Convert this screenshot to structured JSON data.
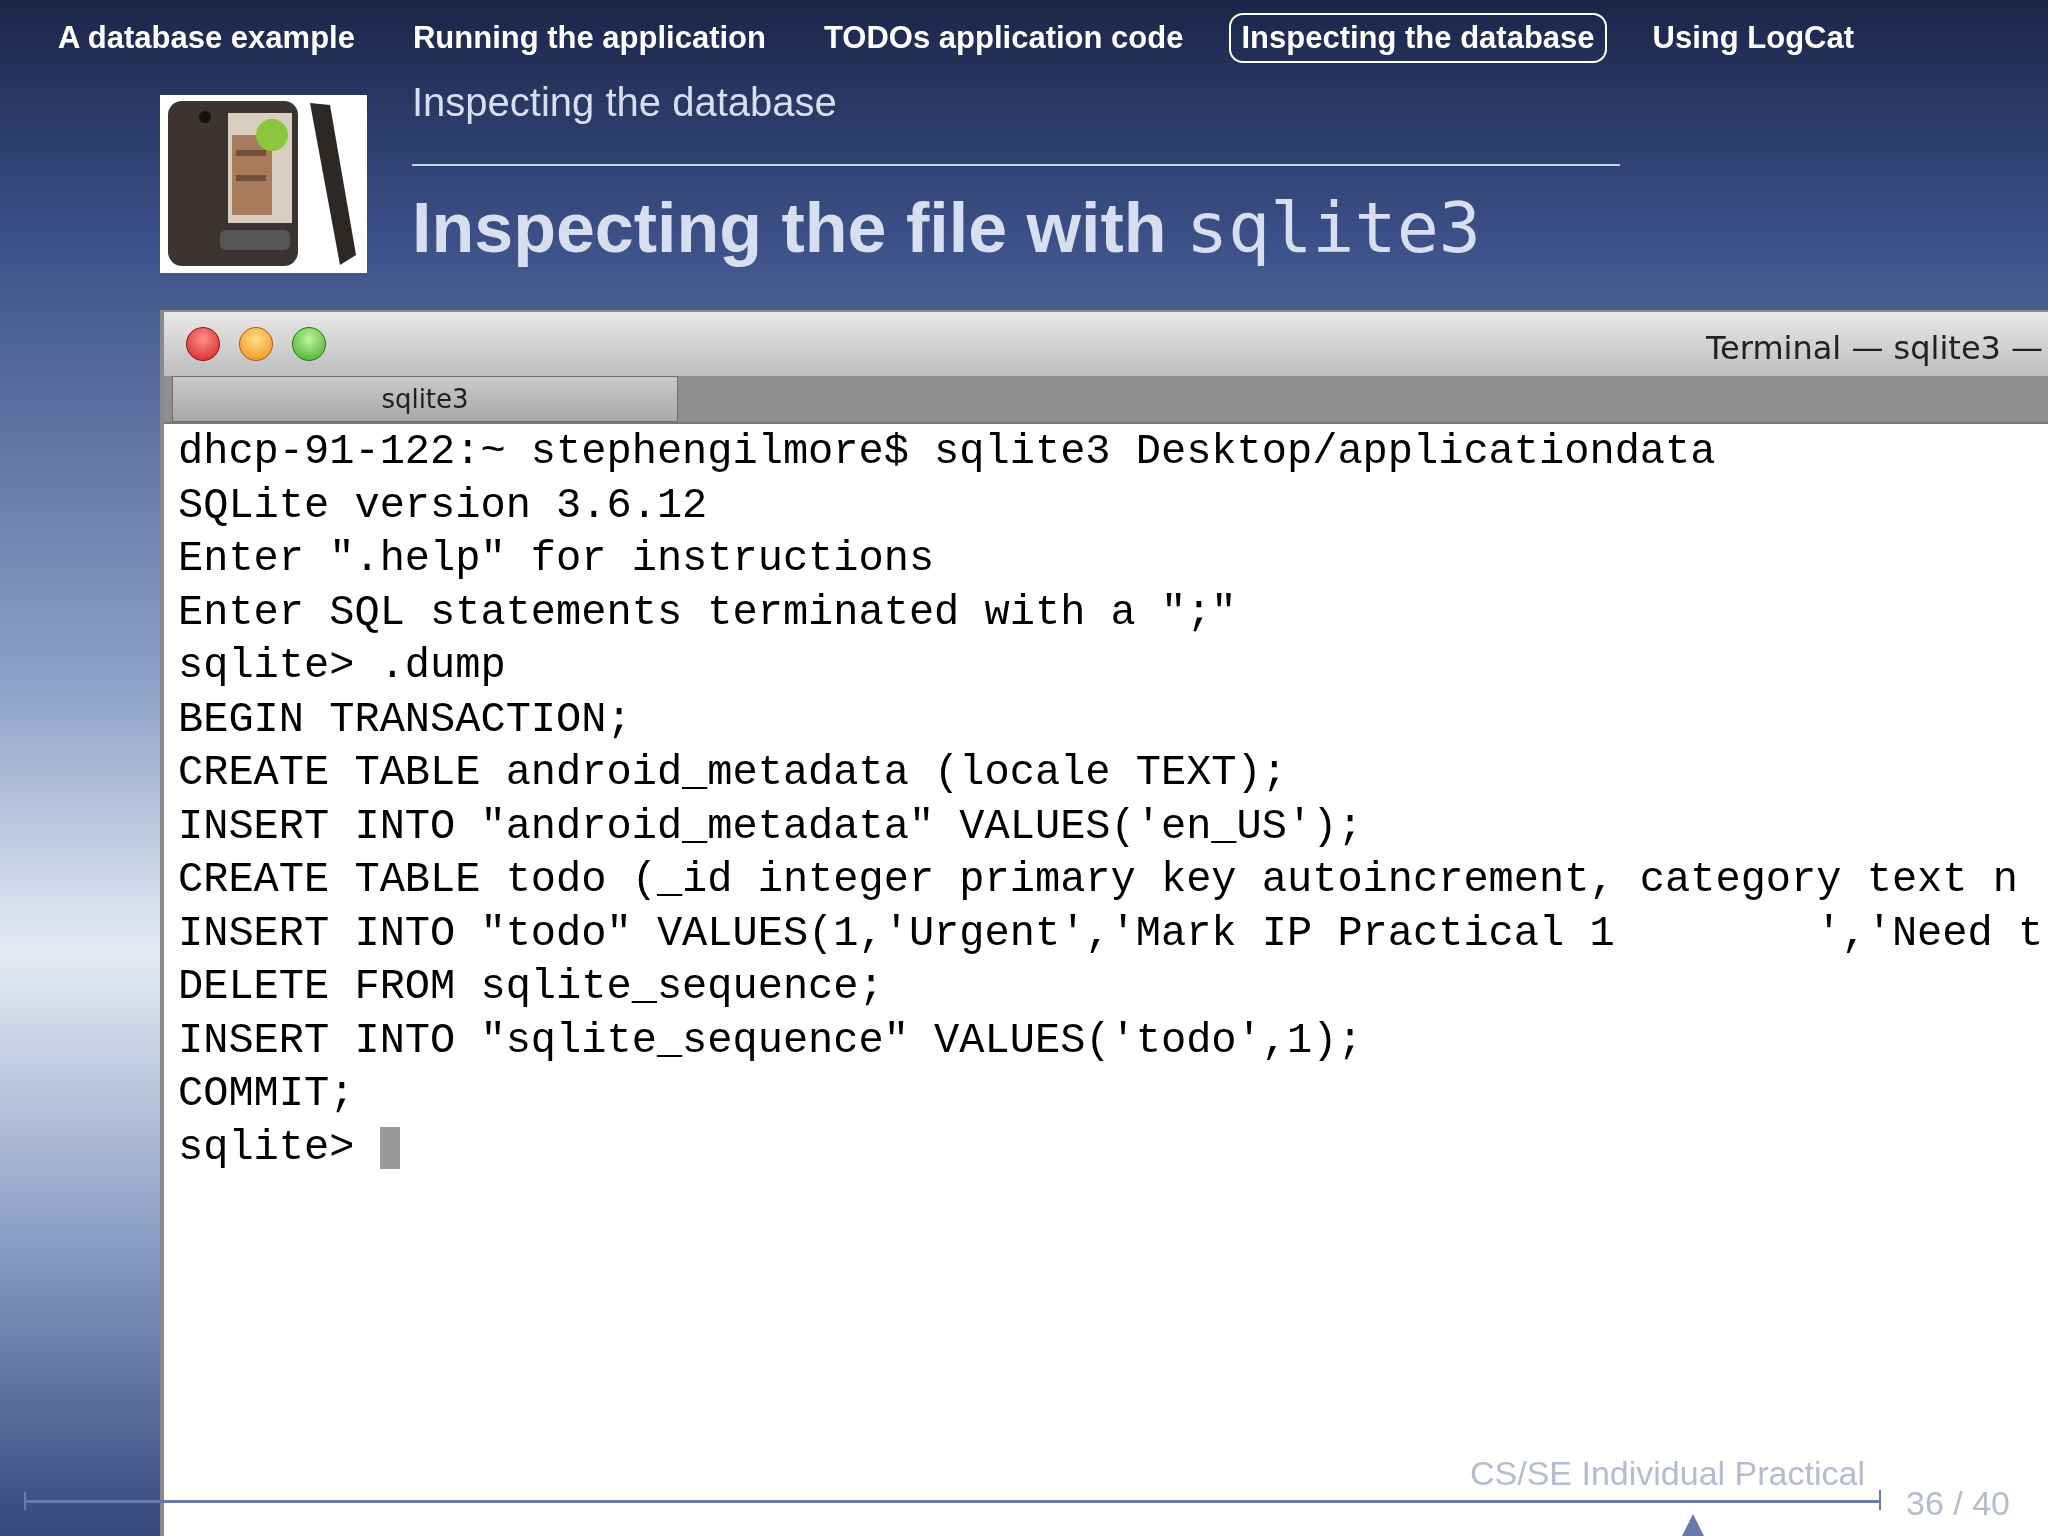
{
  "nav": [
    {
      "label": "A database example",
      "selected": false
    },
    {
      "label": "Running the application",
      "selected": false
    },
    {
      "label": "TODOs application code",
      "selected": false
    },
    {
      "label": "Inspecting the database",
      "selected": true
    },
    {
      "label": "Using LogCat",
      "selected": false
    }
  ],
  "section_title": "Inspecting the database",
  "frame_title": {
    "text": "Inspecting the file with",
    "code": "sqlite3"
  },
  "terminal": {
    "title": "Terminal — sqlite3 —",
    "tabs": [
      {
        "label": "sqlite3",
        "selected": true
      }
    ],
    "lines": [
      "dhcp-91-122:~ stephengilmore$ sqlite3 Desktop/applicationdata",
      "SQLite version 3.6.12",
      "Enter \".help\" for instructions",
      "Enter SQL statements terminated with a \";\"",
      "sqlite> .dump",
      "BEGIN TRANSACTION;",
      "CREATE TABLE android_metadata (locale TEXT);",
      "INSERT INTO \"android_metadata\" VALUES('en_US');",
      "CREATE TABLE todo (_id integer primary key autoincrement, category text n",
      "INSERT INTO \"todo\" VALUES(1,'Urgent','Mark IP Practical 1        ','Need t",
      "DELETE FROM sqlite_sequence;",
      "INSERT INTO \"sqlite_sequence\" VALUES('todo',1);",
      "COMMIT;",
      "sqlite> "
    ],
    "cursor": true
  },
  "footer": {
    "title": "CS/SE Individual Practical",
    "page": "36 / 40"
  }
}
